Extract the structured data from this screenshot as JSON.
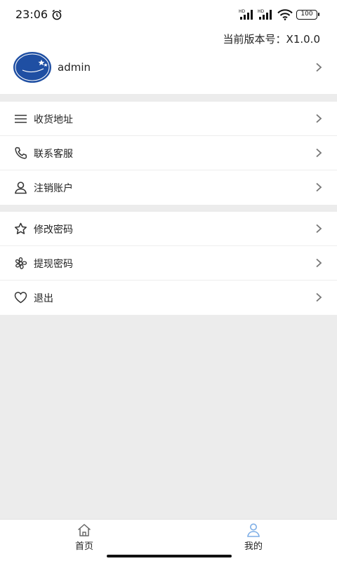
{
  "status_bar": {
    "time": "23:06",
    "signal_tag": "HD",
    "battery": "100"
  },
  "header": {
    "version_text": "当前版本号：X1.0.0"
  },
  "profile": {
    "username": "admin"
  },
  "menu_group_1": [
    {
      "label": "收货地址",
      "icon": "list-icon"
    },
    {
      "label": "联系客服",
      "icon": "phone-icon"
    },
    {
      "label": "注销账户",
      "icon": "user-icon"
    }
  ],
  "menu_group_2": [
    {
      "label": "修改密码",
      "icon": "star-icon"
    },
    {
      "label": "提现密码",
      "icon": "flower-icon"
    },
    {
      "label": "退出",
      "icon": "heart-icon"
    }
  ],
  "tabbar": {
    "home": "首页",
    "mine": "我的"
  },
  "colors": {
    "background": "#ececec",
    "card": "#ffffff",
    "avatar_blue": "#1f4fa3",
    "active_tab_icon": "#7eaee6"
  }
}
